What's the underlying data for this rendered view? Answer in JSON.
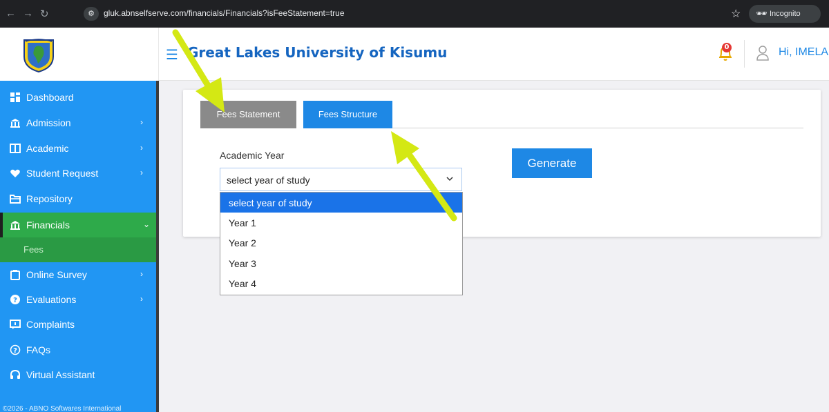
{
  "browser": {
    "url": "gluk.abnselfserve.com/financials/Financials?isFeeStatement=true",
    "incognito_label": "Incognito",
    "back_icon": "arrow-left-icon",
    "forward_icon": "arrow-right-icon",
    "reload_icon": "reload-icon",
    "star_icon": "star-icon"
  },
  "header": {
    "title": "Great Lakes University of Kisumu",
    "greeting": "Hi, IMELA",
    "notification_count": "0",
    "brand_color": "#1565c0"
  },
  "sidebar": {
    "items": [
      {
        "label": "Dashboard",
        "icon": "dashboard-icon"
      },
      {
        "label": "Admission",
        "icon": "building-icon",
        "arrow": "›"
      },
      {
        "label": "Academic",
        "icon": "book-icon",
        "arrow": "›"
      },
      {
        "label": "Student Request",
        "icon": "heart-hand-icon",
        "arrow": "›"
      },
      {
        "label": "Repository",
        "icon": "folder-icon"
      },
      {
        "label": "Financials",
        "icon": "bank-icon",
        "arrow": "⌄"
      },
      {
        "label": "Online Survey",
        "icon": "clipboard-icon",
        "arrow": "›"
      },
      {
        "label": "Evaluations",
        "icon": "help-circle-icon",
        "arrow": "›"
      },
      {
        "label": "Complaints",
        "icon": "comment-icon"
      },
      {
        "label": "FAQs",
        "icon": "question-icon"
      },
      {
        "label": "Virtual Assistant",
        "icon": "headset-icon"
      }
    ],
    "sub_item": "Fees",
    "footer": "©2026 - ABNO Softwares International",
    "bg_color": "#2196f3",
    "active_color": "#2eaa4a"
  },
  "main": {
    "tabs": [
      {
        "label": "Fees Statement"
      },
      {
        "label": "Fees Structure"
      }
    ],
    "field_label": "Academic Year",
    "select_value": "select year of study",
    "generate_label": "Generate",
    "options": [
      "select year of study",
      "Year 1",
      "Year 2",
      "Year 3",
      "Year 4"
    ]
  },
  "annotations": {
    "arrow_color": "#d4e814"
  }
}
